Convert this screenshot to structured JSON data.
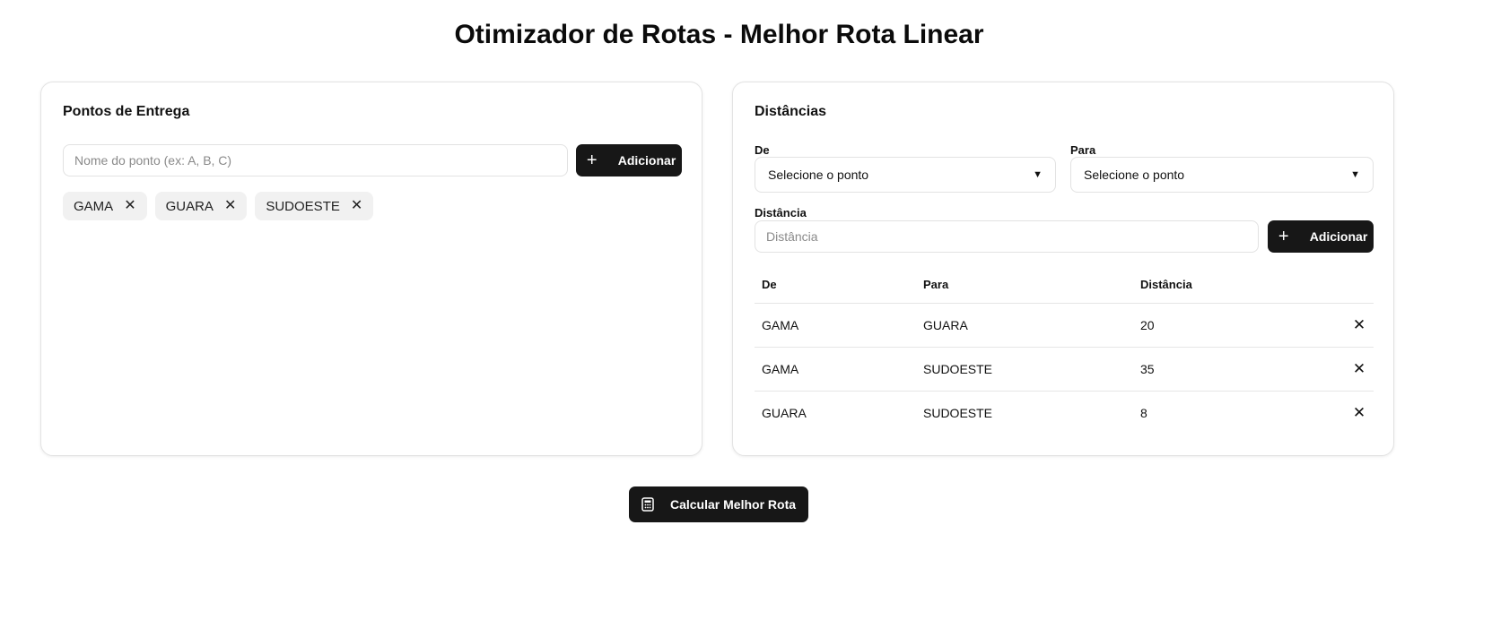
{
  "title": "Otimizador de Rotas - Melhor Rota Linear",
  "points_card": {
    "title": "Pontos de Entrega",
    "input_placeholder": "Nome do ponto (ex: A, B, C)",
    "add_label": "Adicionar",
    "chips": [
      "GAMA",
      "GUARA",
      "SUDOESTE"
    ]
  },
  "distances_card": {
    "title": "Distâncias",
    "from_label": "De",
    "to_label": "Para",
    "from_select_value": "Selecione o ponto",
    "to_select_value": "Selecione o ponto",
    "distance_label": "Distância",
    "distance_placeholder": "Distância",
    "add_label": "Adicionar",
    "table": {
      "headers": [
        "De",
        "Para",
        "Distância"
      ],
      "rows": [
        {
          "from": "GAMA",
          "to": "GUARA",
          "distance": "20"
        },
        {
          "from": "GAMA",
          "to": "SUDOESTE",
          "distance": "35"
        },
        {
          "from": "GUARA",
          "to": "SUDOESTE",
          "distance": "8"
        }
      ]
    }
  },
  "calculate_label": "Calcular Melhor Rota"
}
